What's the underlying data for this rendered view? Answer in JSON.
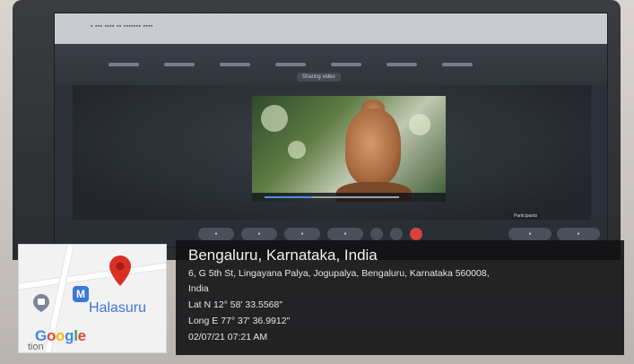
{
  "location": {
    "title": "Bengaluru, Karnataka, India",
    "address_line1": "6, G 5th St, Lingayana Palya, Jogupalya, Bengaluru, Karnataka 560008,",
    "address_line2": "India",
    "latitude": "Lat N 12° 58' 33.5568\"",
    "longitude": "Long E 77° 37' 36.9912\"",
    "datetime": "02/07/21 07:21 AM"
  },
  "map": {
    "place_label": "Halasuru",
    "metro_badge": "M",
    "brand": [
      "G",
      "o",
      "o",
      "g",
      "l",
      "e"
    ],
    "brand_colors": [
      "#4285f4",
      "#ea4335",
      "#fbbc05",
      "#4285f4",
      "#34a853",
      "#ea4335"
    ],
    "partial_text": "tion",
    "pin_color": "#d93025"
  },
  "screen": {
    "share_label": "Sharing video",
    "participants_label": "Participants",
    "video_progress_fraction": 0.35
  }
}
